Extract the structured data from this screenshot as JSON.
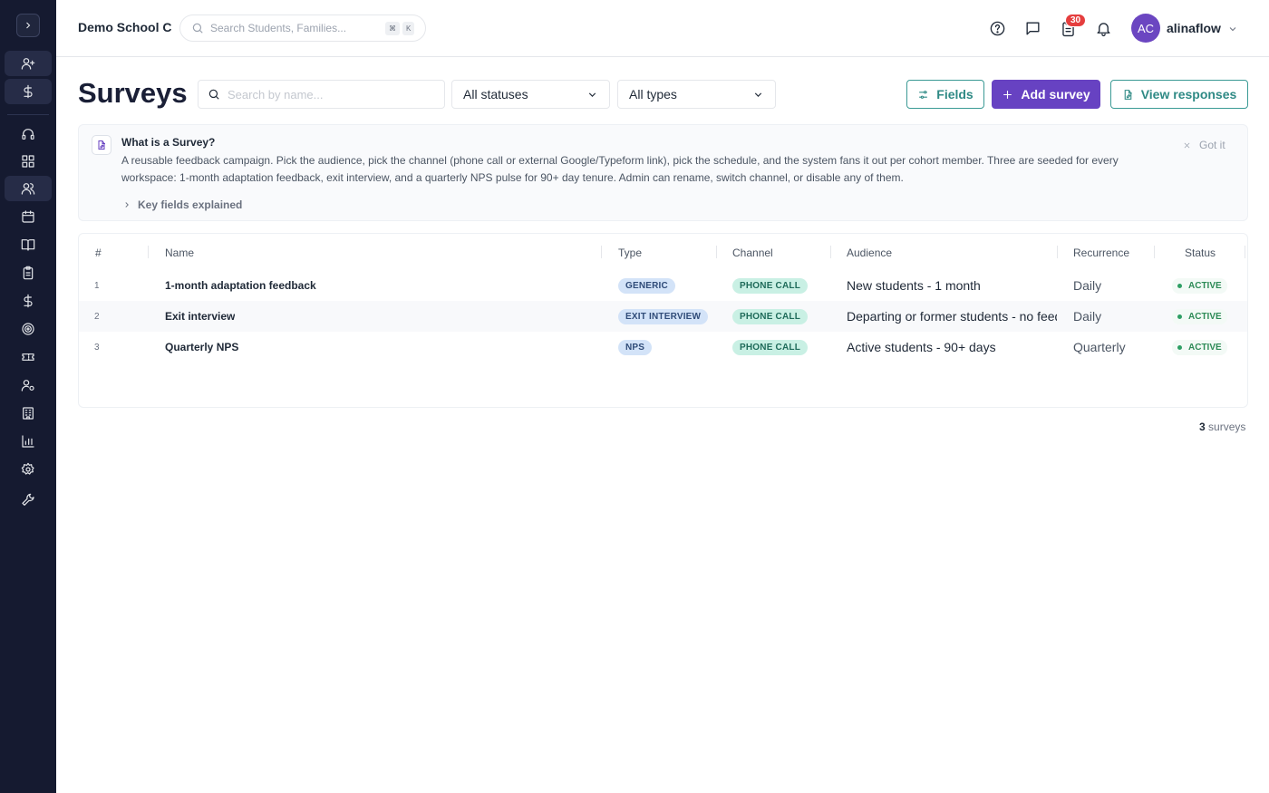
{
  "header": {
    "school_name": "Demo School C",
    "search_placeholder": "Search Students, Families...",
    "shortcut_mod": "⌘",
    "shortcut_key": "K",
    "tasks_badge": "30",
    "user_initials": "AC",
    "user_name": "alinaflow"
  },
  "page": {
    "title": "Surveys",
    "search_placeholder": "Search by name...",
    "status_filter": "All statuses",
    "type_filter": "All types",
    "fields_label": "Fields",
    "add_label": "Add survey",
    "responses_label": "View responses"
  },
  "info": {
    "title": "What is a Survey?",
    "body": "A reusable feedback campaign. Pick the audience, pick the channel (phone call or external Google/Typeform link), pick the schedule, and the system fans it out per cohort member. Three are seeded for every workspace: 1-month adaptation feedback, exit interview, and a quarterly NPS pulse for 90+ day tenure. Admin can rename, switch channel, or disable any of them.",
    "dismiss": "Got it",
    "toggle": "Key fields explained"
  },
  "table": {
    "columns": [
      "#",
      "Name",
      "Type",
      "Channel",
      "Audience",
      "Recurrence",
      "Status"
    ],
    "rows": [
      {
        "num": "1",
        "name": "1-month adaptation feedback",
        "type": "GENERIC",
        "channel": "PHONE CALL",
        "audience": "New students - 1 month",
        "recurrence": "Daily",
        "status": "ACTIVE"
      },
      {
        "num": "2",
        "name": "Exit interview",
        "type": "EXIT INTERVIEW",
        "channel": "PHONE CALL",
        "audience": "Departing or former students - no feedback yet",
        "recurrence": "Daily",
        "status": "ACTIVE"
      },
      {
        "num": "3",
        "name": "Quarterly NPS",
        "type": "NPS",
        "channel": "PHONE CALL",
        "audience": "Active students - 90+ days",
        "recurrence": "Quarterly",
        "status": "ACTIVE"
      }
    ]
  },
  "footer": {
    "count": "3",
    "label": "surveys"
  },
  "sidebar": {
    "icons": [
      "add-user-icon",
      "dollar-icon",
      "headset-icon",
      "dashboard-icon",
      "users-icon",
      "calendar-icon",
      "book-icon",
      "clipboard-icon",
      "dollar-icon",
      "target-icon",
      "ticket-icon",
      "user-settings-icon",
      "building-icon",
      "bar-chart-icon",
      "gear-icon",
      "wrench-icon"
    ]
  }
}
